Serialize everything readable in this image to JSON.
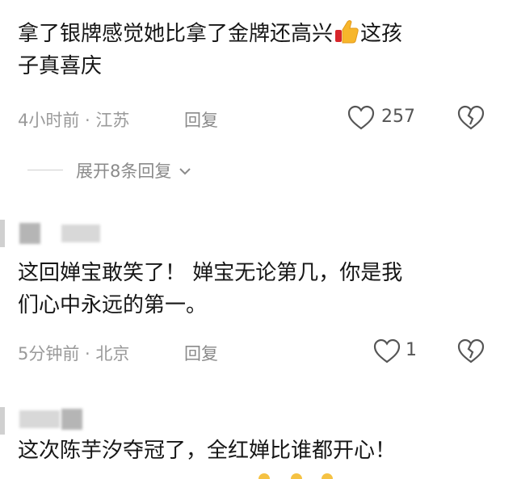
{
  "comments": [
    {
      "text_line1": "拿了银牌感觉她比拿了金牌还高兴",
      "emoji": "thumbs-up",
      "text_line1_end": "这孩",
      "text_line2": "子真喜庆",
      "meta": "4小时前 · 江苏",
      "reply_label": "回复",
      "likes": "257",
      "expand_label": "展开8条回复"
    },
    {
      "text_line1": "这回婵宝敢笑了！ 婵宝无论第几，你是我",
      "text_line2": "们心中永远的第一。",
      "meta": "5分钟前 · 北京",
      "reply_label": "回复",
      "likes": "1"
    },
    {
      "text_line1": "这次陈芋汐夺冠了，全红婵比谁都开心！"
    }
  ],
  "icons": {
    "like": "heart-outline-icon",
    "dislike": "broken-heart-icon",
    "expand": "chevron-down-icon",
    "thumbs_up": "thumbs-up-emoji"
  }
}
